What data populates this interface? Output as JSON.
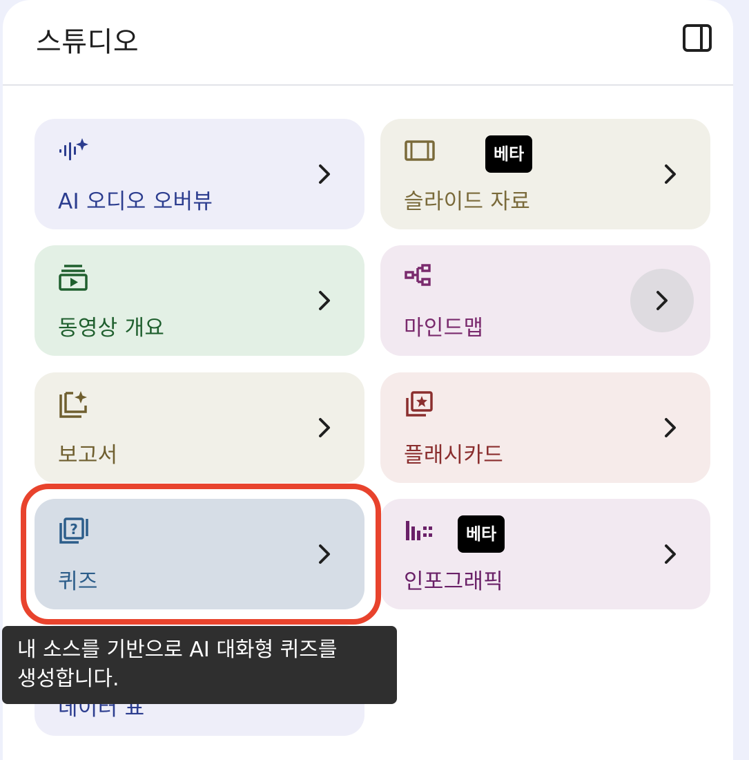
{
  "studio": {
    "title": "스튜디오",
    "panel_toggle_icon": "dock-right-icon"
  },
  "tiles": [
    {
      "label": "AI 오디오 오버뷰",
      "icon": "audio-sparkle-icon",
      "color": "#2c3d8f",
      "bg": "#eeeef9"
    },
    {
      "label": "슬라이드 자료",
      "icon": "slides-icon",
      "badge": "베타",
      "color": "#7a6a3a",
      "bg": "#f1f0e8"
    },
    {
      "label": "동영상 개요",
      "icon": "video-library-icon",
      "color": "#1f5f2e",
      "bg": "#e3f0e5"
    },
    {
      "label": "마인드맵",
      "icon": "mind-map-icon",
      "color": "#7a2a6d",
      "bg": "#f2e9f1"
    },
    {
      "label": "보고서",
      "icon": "report-sparkle-icon",
      "color": "#6f5f2f",
      "bg": "#f1f0e8"
    },
    {
      "label": "플래시카드",
      "icon": "flashcards-icon",
      "color": "#8a2e2e",
      "bg": "#f6ebea"
    },
    {
      "label": "퀴즈",
      "icon": "quiz-icon",
      "color": "#2c5d8a",
      "bg": "#d6dde6"
    },
    {
      "label": "인포그래픽",
      "icon": "infographic-icon",
      "badge": "베타",
      "color": "#6a2168",
      "bg": "#f2e9f1"
    },
    {
      "label": "데이터 표",
      "icon": "table-icon",
      "color": "#2c3d8f",
      "bg": "#eeeef9"
    }
  ],
  "tooltip": {
    "line1": "내 소스를 기반으로 AI 대화형 퀴즈를",
    "line2": "생성합니다."
  },
  "colors": {
    "highlight_border": "#e8432d",
    "tooltip_bg": "#2f2f2f"
  }
}
